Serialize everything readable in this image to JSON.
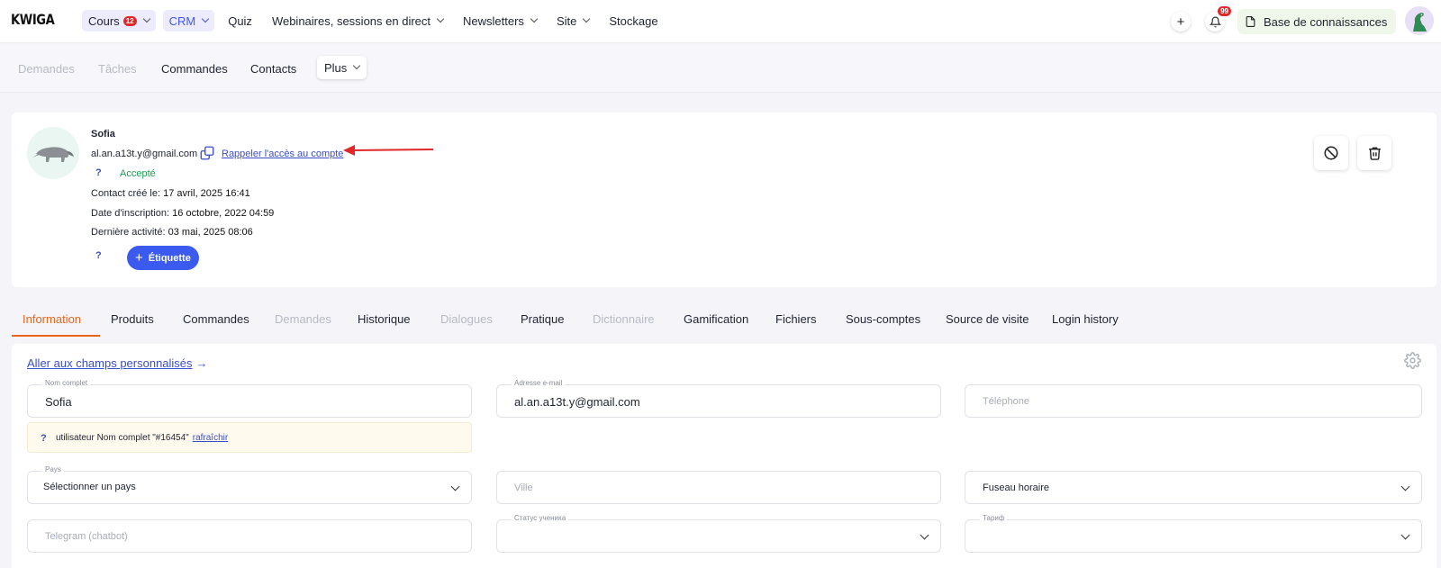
{
  "app": {
    "logo": "KWIGA"
  },
  "topnav": {
    "items": [
      {
        "label": "Cours",
        "badge": "12"
      },
      {
        "label": "CRM"
      },
      {
        "label": "Quiz"
      },
      {
        "label": "Webinaires, sessions en direct"
      },
      {
        "label": "Newsletters"
      },
      {
        "label": "Site"
      },
      {
        "label": "Stockage"
      }
    ],
    "add_glyph": "+",
    "notifications_badge": "99",
    "knowledge_base": "Base de connaissances"
  },
  "subnav": {
    "items": [
      "Demandes",
      "Tâches",
      "Commandes",
      "Contacts"
    ],
    "more": "Plus"
  },
  "contact": {
    "name": "Sofia",
    "email": "al.an.a13t.y@gmail.com",
    "recall_link": "Rappeler l'accès au compte",
    "help_glyph": "?",
    "status": "Accepté",
    "created_label": "Contact créé le:",
    "created_value": "17 avril, 2025 16:41",
    "registered_label": "Date d'inscription:",
    "registered_value": "16 octobre, 2022 04:59",
    "last_activity_label": "Dernière activité:",
    "last_activity_value": "03 mai, 2025 08:06",
    "tag_button": "Étiquette",
    "tag_plus": "+"
  },
  "tabs": [
    "Information",
    "Produits",
    "Commandes",
    "Demandes",
    "Historique",
    "Dialogues",
    "Pratique",
    "Dictionnaire",
    "Gamification",
    "Fichiers",
    "Sous-comptes",
    "Source de visite",
    "Login history"
  ],
  "form": {
    "custom_fields_link": "Aller aux champs personnalisés",
    "custom_fields_arrow": "→",
    "full_name_label": "Nom complet",
    "full_name_value": "Sofia",
    "email_label": "Adresse e-mail",
    "email_value": "al.an.a13t.y@gmail.com",
    "phone_placeholder": "Téléphone",
    "notice_glyph": "?",
    "notice_text": "utilisateur Nom complet \"#16454\"",
    "notice_link": "rafraîchir",
    "country_label": "Pays",
    "country_value": "Sélectionner un pays",
    "city_placeholder": "Ville",
    "timezone_value": "Fuseau horaire",
    "telegram_placeholder": "Telegram (chatbot)",
    "student_status_label": "Статус ученика",
    "tariff_label": "Тариф"
  },
  "colors": {
    "accent": "#3b5bf0",
    "link": "#3a4dc7",
    "active_tab": "#e8641d",
    "accepted": "#1f9d55",
    "badge": "#e0282b",
    "annotation_arrow": "#e0282b"
  }
}
